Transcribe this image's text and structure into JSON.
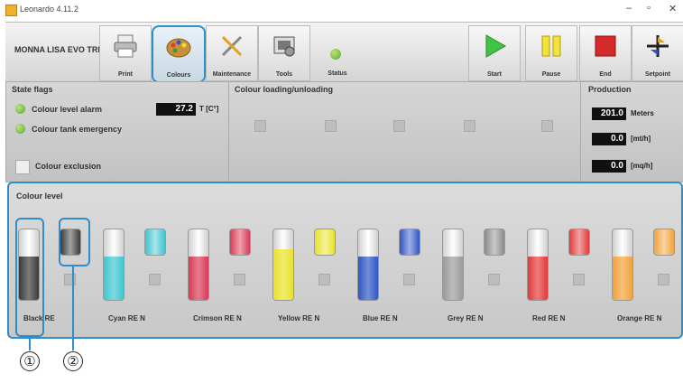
{
  "window": {
    "title": "Leonardo 4.11.2",
    "controls": [
      "–",
      "▫",
      "✕"
    ]
  },
  "toolbar": {
    "machine_name": "MONNA LISA EVO TRE",
    "buttons": {
      "print": "Print",
      "colours": "Colours",
      "maintenance": "Maintenance",
      "tools": "Tools",
      "status": "Status",
      "start": "Start",
      "pause": "Pause",
      "end": "End",
      "setpoint": "Setpoint"
    }
  },
  "state_flags": {
    "title": "State flags",
    "colour_level_alarm": "Colour level alarm",
    "temperature_value": "27.2",
    "temperature_unit": "T [C°]",
    "colour_tank_emergency": "Colour tank emergency",
    "colour_exclusion": "Colour exclusion"
  },
  "loading": {
    "title": "Colour loading/unloading"
  },
  "production": {
    "title": "Production",
    "meters_value": "201.0",
    "meters_unit": "Meters",
    "speed_value": "0.0",
    "speed_unit": "[mt/h]",
    "area_value": "0.0",
    "area_unit": "[mq/h]"
  },
  "colour_level": {
    "title": "Colour level",
    "tanks": [
      {
        "name": "Black RE",
        "color": "#3a3a3a",
        "level": 0.62,
        "small_color": "#3a3a3a"
      },
      {
        "name": "Cyan RE N",
        "color": "#3fc6cf",
        "level": 0.62,
        "small_color": "#3fc6cf"
      },
      {
        "name": "Crimson RE N",
        "color": "#d83a56",
        "level": 0.62,
        "small_color": "#d83a56"
      },
      {
        "name": "Yellow RE N",
        "color": "#e8e22a",
        "level": 0.72,
        "small_color": "#e8e22a"
      },
      {
        "name": "Blue RE N",
        "color": "#2f56c4",
        "level": 0.62,
        "small_color": "#2f56c4"
      },
      {
        "name": "Grey RE N",
        "color": "#9a9a9a",
        "level": 0.62,
        "small_color": "#8a8a8a"
      },
      {
        "name": "Red RE N",
        "color": "#e23a3a",
        "level": 0.62,
        "small_color": "#e23a3a"
      },
      {
        "name": "Orange RE N",
        "color": "#f2a23a",
        "level": 0.62,
        "small_color": "#f2a23a"
      }
    ]
  },
  "callouts": [
    "①",
    "②"
  ]
}
